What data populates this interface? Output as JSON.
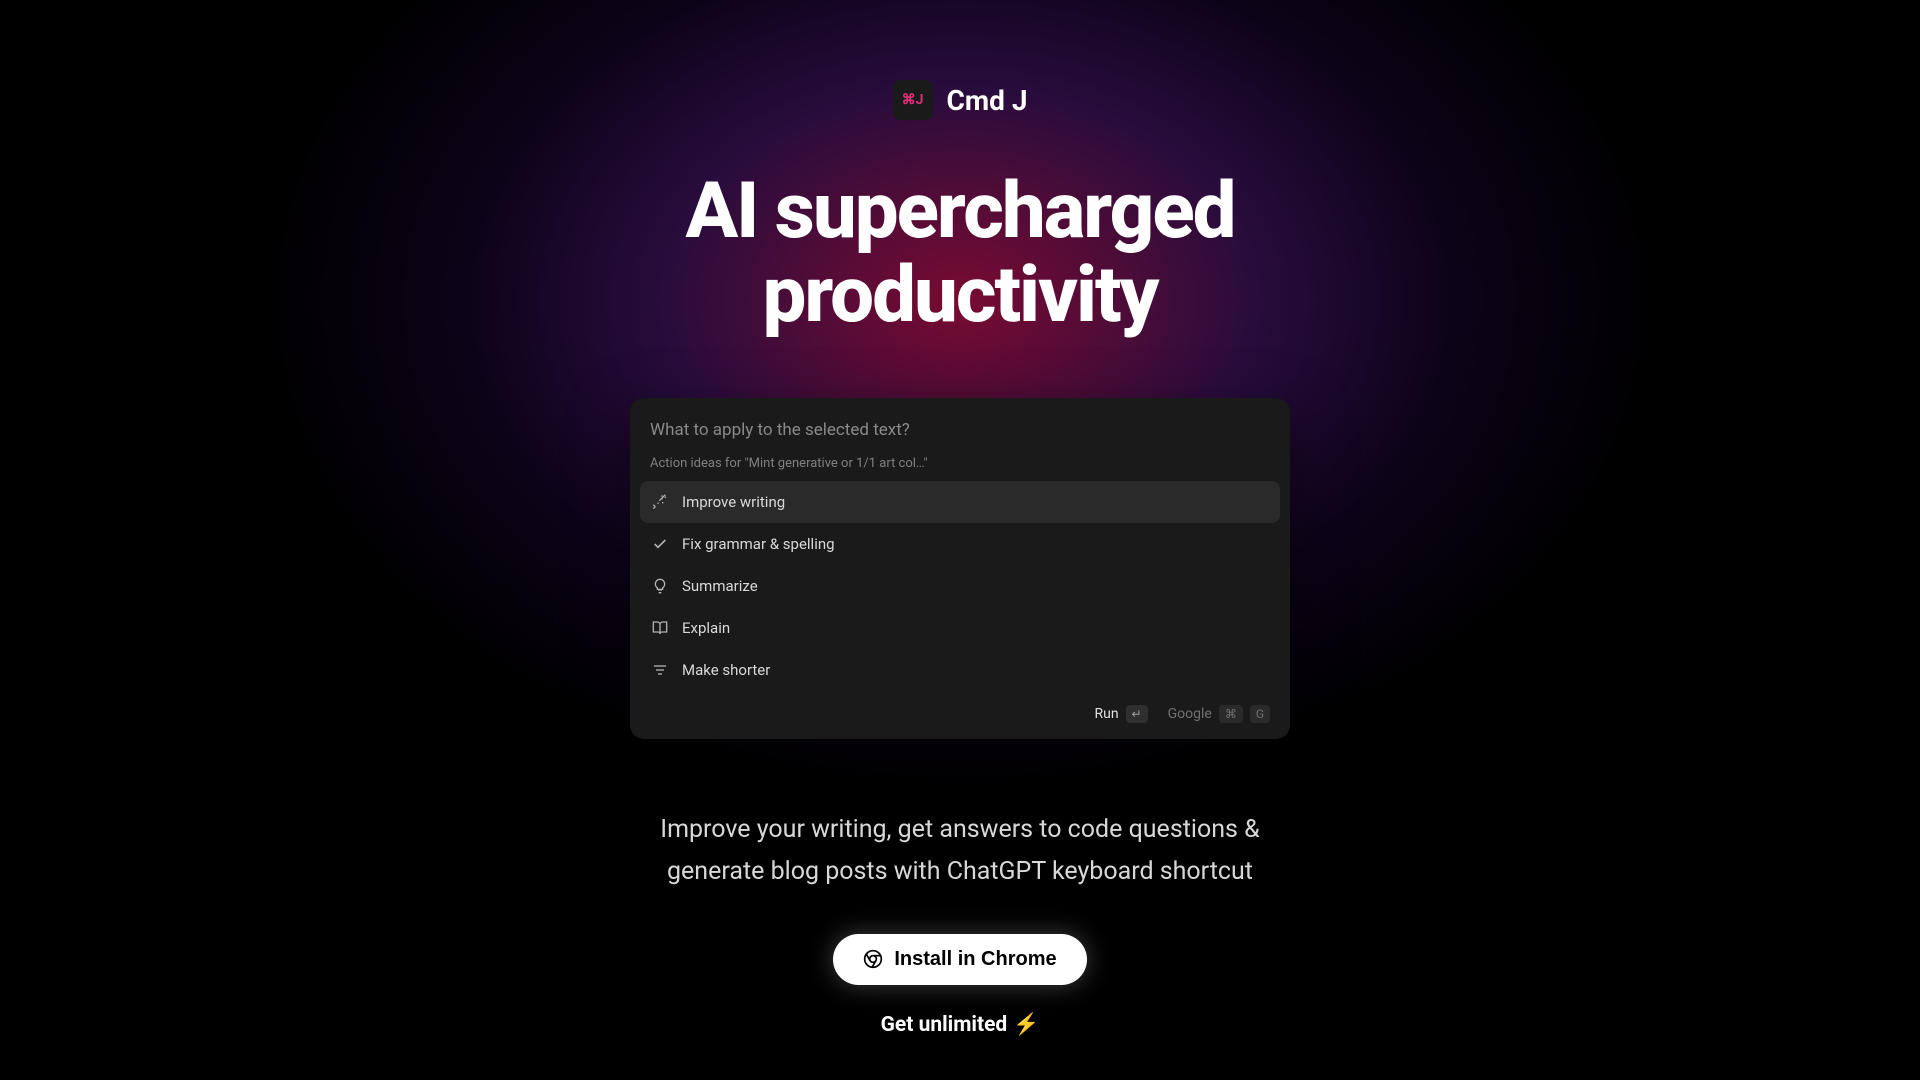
{
  "logo": {
    "badge_text": "⌘J",
    "name": "Cmd J"
  },
  "hero": {
    "title_line1": "AI supercharged",
    "title_line2": "productivity"
  },
  "palette": {
    "placeholder": "What to apply to the selected text?",
    "section_label": "Action ideas for \"Mint generative or 1/1 art col…\"",
    "items": [
      {
        "icon": "wand",
        "label": "Improve writing",
        "selected": true
      },
      {
        "icon": "check",
        "label": "Fix grammar & spelling",
        "selected": false
      },
      {
        "icon": "bulb",
        "label": "Summarize",
        "selected": false
      },
      {
        "icon": "book",
        "label": "Explain",
        "selected": false
      },
      {
        "icon": "shorten",
        "label": "Make shorter",
        "selected": false
      }
    ],
    "footer": {
      "run_label": "Run",
      "run_key": "↵",
      "google_label": "Google",
      "google_cmd": "⌘",
      "google_key": "G"
    }
  },
  "subtitle": "Improve your writing, get answers to code questions & generate blog posts with ChatGPT keyboard shortcut",
  "install_button": "Install in Chrome",
  "unlimited": {
    "text": "Get unlimited",
    "emoji": "⚡"
  }
}
